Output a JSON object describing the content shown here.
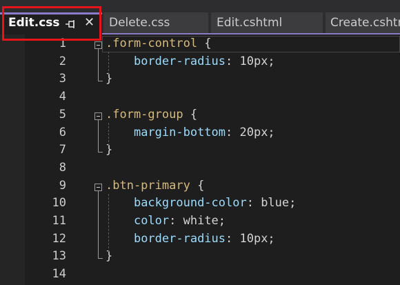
{
  "tabs": [
    {
      "label": "Edit.css",
      "active": true
    },
    {
      "label": "Delete.css"
    },
    {
      "label": "Edit.cshtml"
    },
    {
      "label": "Create.cshtml"
    }
  ],
  "icons": {
    "pin": "pin-icon",
    "close": "close-icon"
  },
  "colors": {
    "accent": "#8a7cc8",
    "highlight_box": "#e8141a",
    "selector": "#d7ba7d",
    "property": "#9cdcfe"
  },
  "editor": {
    "line_numbers": [
      "1",
      "2",
      "3",
      "4",
      "5",
      "6",
      "7",
      "8",
      "9",
      "10",
      "11",
      "12",
      "13",
      "14"
    ],
    "lines": [
      {
        "sel": ".form-control",
        "brace": " {"
      },
      {
        "prop": "border-radius",
        "val": ": 10px;"
      },
      {
        "brace": "}"
      },
      {},
      {
        "sel": ".form-group",
        "brace": " {"
      },
      {
        "prop": "margin-bottom",
        "val": ": 20px;"
      },
      {
        "brace": "}"
      },
      {},
      {
        "sel": ".btn-primary",
        "brace": " {"
      },
      {
        "prop": "background-color",
        "val": ": blue;"
      },
      {
        "prop": "color",
        "val": ": white;"
      },
      {
        "prop": "border-radius",
        "val": ": 10px;"
      },
      {
        "brace": "}"
      },
      {}
    ]
  }
}
